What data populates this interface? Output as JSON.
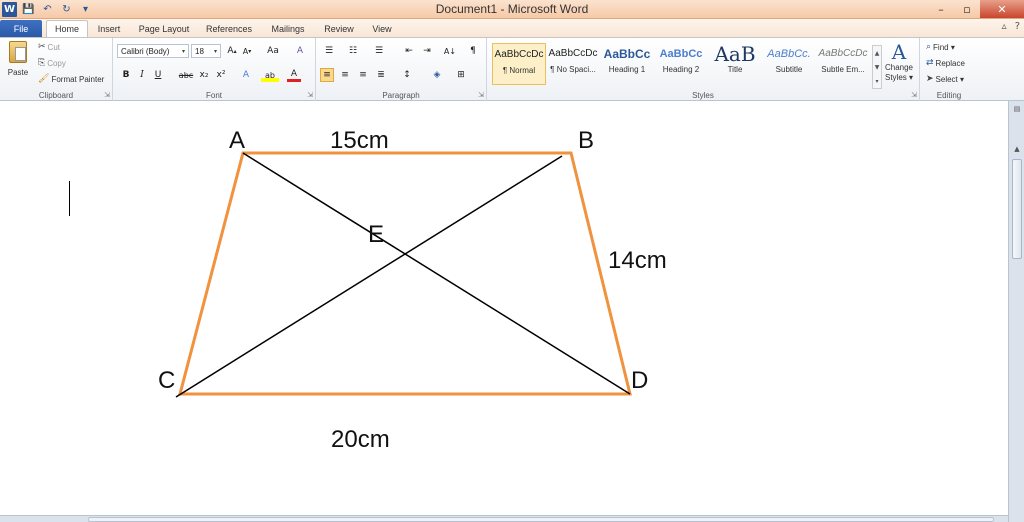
{
  "window": {
    "title": "Document1 - Microsoft Word",
    "controls": {
      "minimize": "–",
      "maximize": "▫",
      "close": "✕"
    }
  },
  "quick_access": {
    "app_icon": "W",
    "save": "💾",
    "undo": "↶",
    "redo": "↻",
    "customize": "▾"
  },
  "tabs": [
    {
      "label": "File"
    },
    {
      "label": "Home"
    },
    {
      "label": "Insert"
    },
    {
      "label": "Page Layout"
    },
    {
      "label": "References"
    },
    {
      "label": "Mailings"
    },
    {
      "label": "Review"
    },
    {
      "label": "View"
    }
  ],
  "ribbon_right": {
    "minimize": "▵",
    "help": "?"
  },
  "clipboard": {
    "label": "Clipboard",
    "paste": "Paste",
    "cut": "Cut",
    "copy": "Copy",
    "format_painter": "Format Painter"
  },
  "font": {
    "label": "Font",
    "family": "Calibri (Body)",
    "size": "18",
    "grow": "A",
    "shrink": "A",
    "case": "Aa",
    "clear": "A",
    "bold": "B",
    "italic": "I",
    "underline": "U",
    "strike": "abc",
    "sub": "x₂",
    "sup": "x²",
    "effects": "A",
    "highlight": "ab",
    "color": "A"
  },
  "paragraph": {
    "label": "Paragraph",
    "show_marks": "¶",
    "sort": "A↓"
  },
  "styles": {
    "label": "Styles",
    "items": [
      {
        "preview": "AaBbCcDc",
        "name": "¶ Normal"
      },
      {
        "preview": "AaBbCcDc",
        "name": "¶ No Spaci..."
      },
      {
        "preview": "AaBbCc",
        "name": "Heading 1"
      },
      {
        "preview": "AaBbCc",
        "name": "Heading 2"
      },
      {
        "preview": "AaB",
        "name": "Title"
      },
      {
        "preview": "AaBbCc.",
        "name": "Subtitle"
      },
      {
        "preview": "AaBbCcDc",
        "name": "Subtle Em..."
      }
    ],
    "change_styles": "Change Styles ▾",
    "change_icon": "A"
  },
  "editing": {
    "label": "Editing",
    "find": "Find ▾",
    "replace": "Replace",
    "select": "Select ▾"
  },
  "figure": {
    "vertices": {
      "a": "A",
      "b": "B",
      "c": "C",
      "d": "D",
      "e": "E"
    },
    "measures": {
      "top": "15cm",
      "right": "14cm",
      "bottom": "20cm"
    },
    "colors": {
      "outline": "#f0923e",
      "diagonal": "#000000"
    }
  }
}
